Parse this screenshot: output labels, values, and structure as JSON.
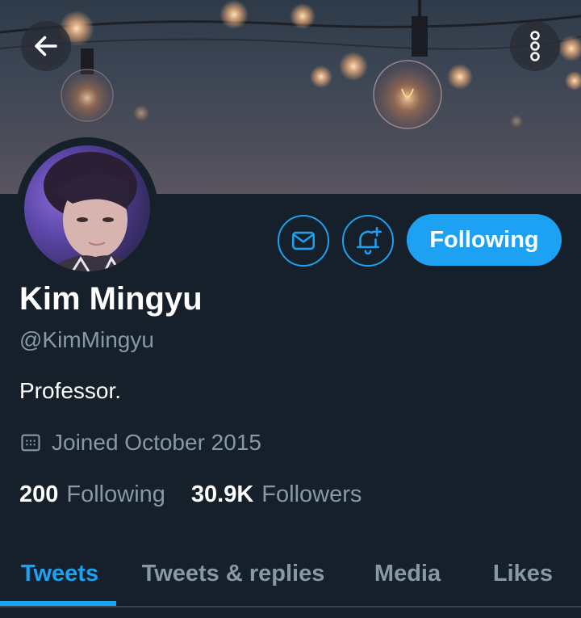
{
  "header": {
    "back_icon": "arrow-left-icon",
    "more_icon": "more-vertical-icon"
  },
  "profile": {
    "name": "Kim Mingyu",
    "handle": "@KimMingyu",
    "bio": "Professor.",
    "joined": "Joined October 2015",
    "joined_icon": "calendar-icon"
  },
  "actions": {
    "message_icon": "mail-icon",
    "notify_icon": "bell-plus-icon",
    "follow_label": "Following"
  },
  "stats": {
    "following_count": "200",
    "following_label": "Following",
    "followers_count": "30.9K",
    "followers_label": "Followers"
  },
  "tabs": [
    {
      "label": "Tweets",
      "active": true
    },
    {
      "label": "Tweets & replies",
      "active": false
    },
    {
      "label": "Media",
      "active": false
    },
    {
      "label": "Likes",
      "active": false
    }
  ],
  "colors": {
    "background": "#15202b",
    "accent": "#1da1f2",
    "secondary_text": "#8899a6"
  }
}
